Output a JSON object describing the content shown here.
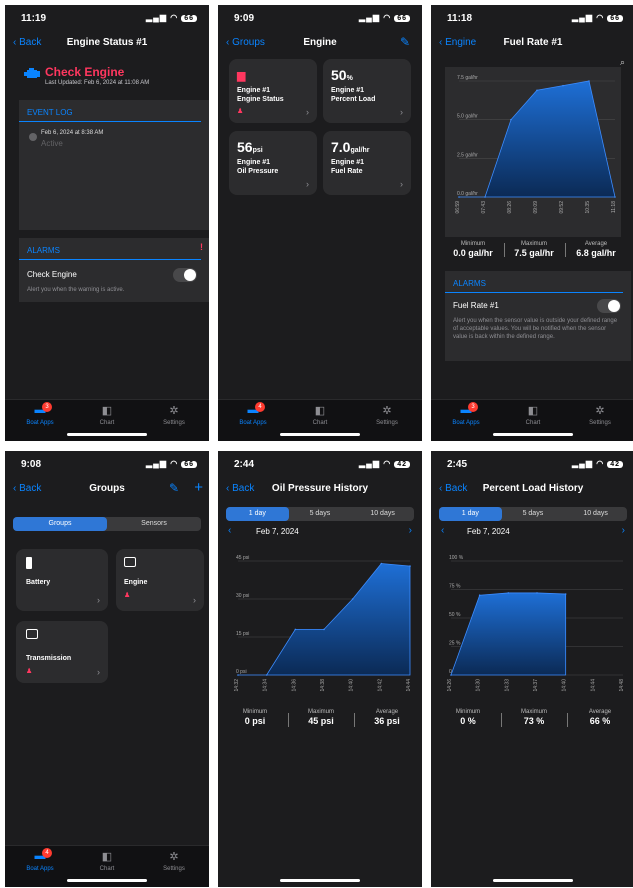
{
  "colors": {
    "accent": "#0a84ff",
    "alert": "#ff375f",
    "background": "#1c1c1e",
    "card": "#2c2c2e",
    "chart_fill": "#1e6fd6"
  },
  "tabbar": {
    "apps": "Boat Apps",
    "chart": "Chart",
    "settings": "Settings",
    "badge": "3",
    "badge_alt": "4"
  },
  "s1": {
    "time": "11:19",
    "battery": "66",
    "back": "Back",
    "title": "Engine Status #1",
    "alert_title": "Check Engine",
    "updated": "Last Updated: Feb 6, 2024 at 11:08 AM",
    "event_log": "EVENT LOG",
    "event_date": "Feb 6, 2024 at 8:38 AM",
    "event_state": "Active",
    "alarms": "ALARMS",
    "alarm_name": "Check Engine",
    "alarm_desc": "Alert you when the warning is active."
  },
  "s2": {
    "time": "9:09",
    "battery": "66",
    "back": "Groups",
    "title": "Engine",
    "cards": [
      {
        "value": "",
        "unit": "",
        "l1": "Engine #1",
        "l2": "Engine Status"
      },
      {
        "value": "50",
        "unit": "%",
        "l1": "Engine #1",
        "l2": "Percent Load"
      },
      {
        "value": "56",
        "unit": "psi",
        "l1": "Engine #1",
        "l2": "Oil Pressure"
      },
      {
        "value": "7.0",
        "unit": "gal/hr",
        "l1": "Engine #1",
        "l2": "Fuel Rate"
      }
    ]
  },
  "s3": {
    "time": "11:18",
    "battery": "66",
    "back": "Engine",
    "title": "Fuel Rate #1",
    "min_label": "Minimum",
    "min": "0.0 gal/hr",
    "max_label": "Maximum",
    "max": "7.5 gal/hr",
    "avg_label": "Average",
    "avg": "6.8 gal/hr",
    "alarms": "ALARMS",
    "alarm_name": "Fuel Rate #1",
    "alarm_desc": "Alert you when the sensor value is outside your defined range of acceptable values. You will be notified when the sensor value is back within the defined range."
  },
  "s4": {
    "time": "9:08",
    "battery": "66",
    "back": "Back",
    "title": "Groups",
    "seg_groups": "Groups",
    "seg_sensors": "Sensors",
    "groups": [
      {
        "name": "Battery"
      },
      {
        "name": "Engine"
      },
      {
        "name": "Transmission"
      }
    ]
  },
  "s5": {
    "time": "2:44",
    "battery": "42",
    "back": "Back",
    "title": "Oil Pressure History",
    "range": [
      "1 day",
      "5 days",
      "10 days"
    ],
    "date": "Feb 7, 2024",
    "min_label": "Minimum",
    "min": "0 psi",
    "max_label": "Maximum",
    "max": "45 psi",
    "avg_label": "Average",
    "avg": "36 psi"
  },
  "s6": {
    "time": "2:45",
    "battery": "42",
    "back": "Back",
    "title": "Percent Load History",
    "range": [
      "1 day",
      "5 days",
      "10 days"
    ],
    "date": "Feb 7, 2024",
    "min_label": "Minimum",
    "min": "0 %",
    "max_label": "Maximum",
    "max": "73 %",
    "avg_label": "Average",
    "avg": "66 %"
  },
  "chart_data": [
    {
      "type": "area",
      "title": "Fuel Rate #1",
      "x": [
        "06:59",
        "07:43",
        "08:26",
        "09:09",
        "09:52",
        "10:35",
        "11:18"
      ],
      "y_ticks": [
        "0.0 gal/hr",
        "2.5 gal/hr",
        "5.0 gal/hr",
        "7.5 gal/hr"
      ],
      "ylim": [
        0,
        7.5
      ],
      "series": [
        {
          "values": [
            0,
            0,
            5,
            6.9,
            7.2,
            7.5,
            0
          ]
        }
      ]
    },
    {
      "type": "area",
      "title": "Oil Pressure History",
      "x": [
        "14:32",
        "14:34",
        "14:36",
        "14:38",
        "14:40",
        "14:42",
        "14:44"
      ],
      "y_ticks": [
        "0 psi",
        "15 psi",
        "30 psi",
        "45 psi"
      ],
      "ylim": [
        0,
        45
      ],
      "series": [
        {
          "values": [
            0,
            0,
            18,
            18,
            30,
            44,
            43
          ]
        }
      ]
    },
    {
      "type": "area",
      "title": "Percent Load History",
      "x": [
        "14:26",
        "14:30",
        "14:33",
        "14:37",
        "14:40",
        "14:44",
        "14:48"
      ],
      "y_ticks": [
        "0 %",
        "25 %",
        "50 %",
        "75 %",
        "100 %"
      ],
      "ylim": [
        0,
        100
      ],
      "series": [
        {
          "values": [
            0,
            70,
            72,
            72,
            71,
            null,
            null
          ]
        }
      ]
    }
  ]
}
